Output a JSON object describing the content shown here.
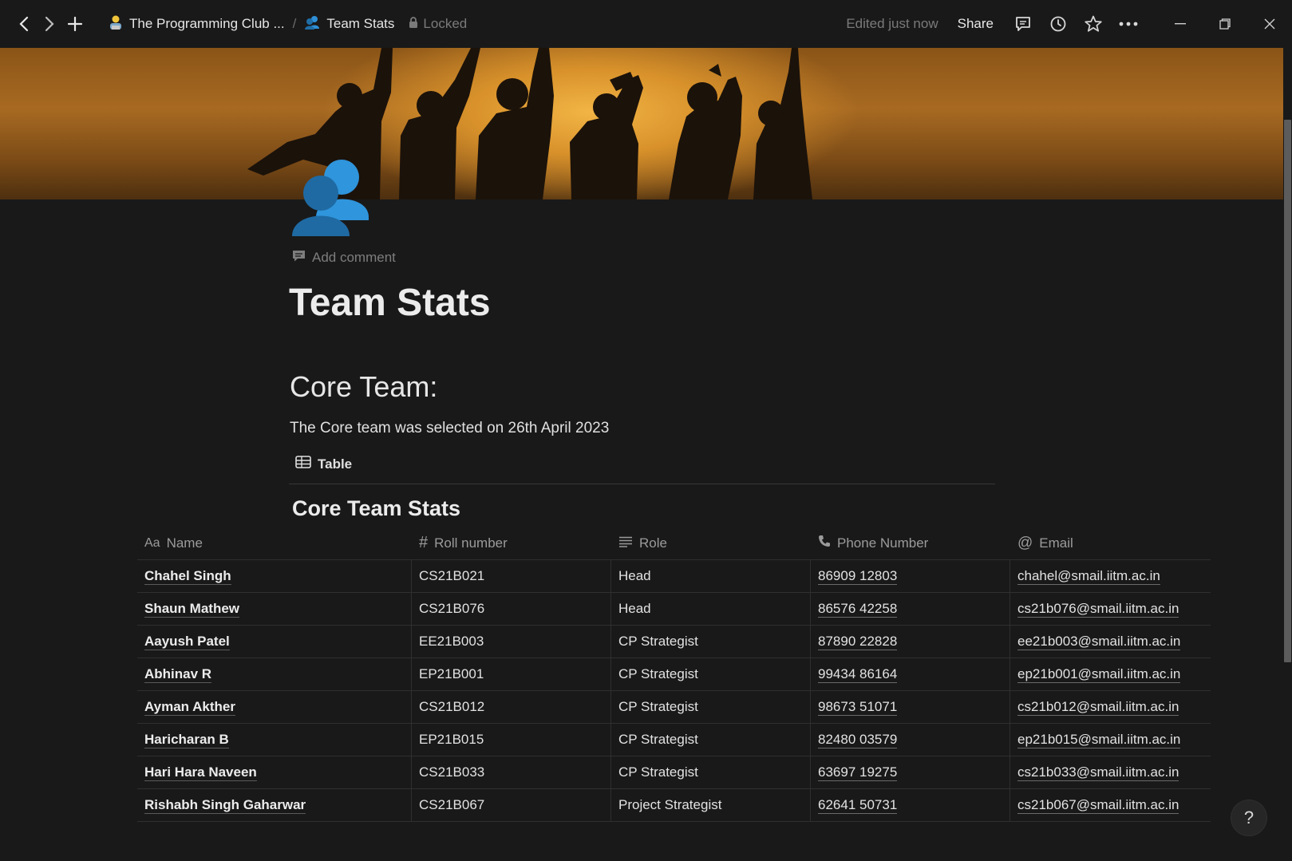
{
  "topbar": {
    "workspace": "The Programming Club ...",
    "separator": "/",
    "page": "Team Stats",
    "locked": "Locked",
    "edited": "Edited just now",
    "share": "Share"
  },
  "page": {
    "add_comment": "Add comment",
    "title": "Team Stats",
    "heading": "Core Team:",
    "paragraph": "The Core team was selected on 26th April 2023",
    "view_tab": "Table",
    "db_title": "Core Team Stats"
  },
  "table": {
    "columns": [
      {
        "label": "Name",
        "icon": "Aa"
      },
      {
        "label": "Roll number",
        "icon": "#"
      },
      {
        "label": "Role",
        "icon": "text-lines-icon"
      },
      {
        "label": "Phone Number",
        "icon": "phone-icon"
      },
      {
        "label": "Email",
        "icon": "@"
      }
    ],
    "rows": [
      {
        "name": "Chahel Singh",
        "roll": "CS21B021",
        "role": "Head",
        "phone": "86909 12803",
        "email": "chahel@smail.iitm.ac.in"
      },
      {
        "name": "Shaun Mathew",
        "roll": "CS21B076",
        "role": "Head",
        "phone": "86576 42258",
        "email": "cs21b076@smail.iitm.ac.in"
      },
      {
        "name": "Aayush Patel",
        "roll": "EE21B003",
        "role": "CP Strategist",
        "phone": "87890 22828",
        "email": "ee21b003@smail.iitm.ac.in"
      },
      {
        "name": "Abhinav R",
        "roll": "EP21B001",
        "role": "CP Strategist",
        "phone": "99434 86164",
        "email": "ep21b001@smail.iitm.ac.in"
      },
      {
        "name": "Ayman Akther",
        "roll": "CS21B012",
        "role": "CP Strategist",
        "phone": "98673 51071",
        "email": "cs21b012@smail.iitm.ac.in"
      },
      {
        "name": "Haricharan B",
        "roll": "EP21B015",
        "role": "CP Strategist",
        "phone": "82480 03579",
        "email": "ep21b015@smail.iitm.ac.in"
      },
      {
        "name": "Hari Hara Naveen",
        "roll": "CS21B033",
        "role": "CP Strategist",
        "phone": "63697 19275",
        "email": "cs21b033@smail.iitm.ac.in"
      },
      {
        "name": "Rishabh Singh Gaharwar",
        "roll": "CS21B067",
        "role": "Project Strategist",
        "phone": "62641 50731",
        "email": "cs21b067@smail.iitm.ac.in"
      }
    ]
  },
  "help": "?",
  "colors": {
    "background": "#191919",
    "accent_icon": "#2b86c8",
    "text": "#e2e2e2",
    "muted": "#7d7d7d"
  }
}
